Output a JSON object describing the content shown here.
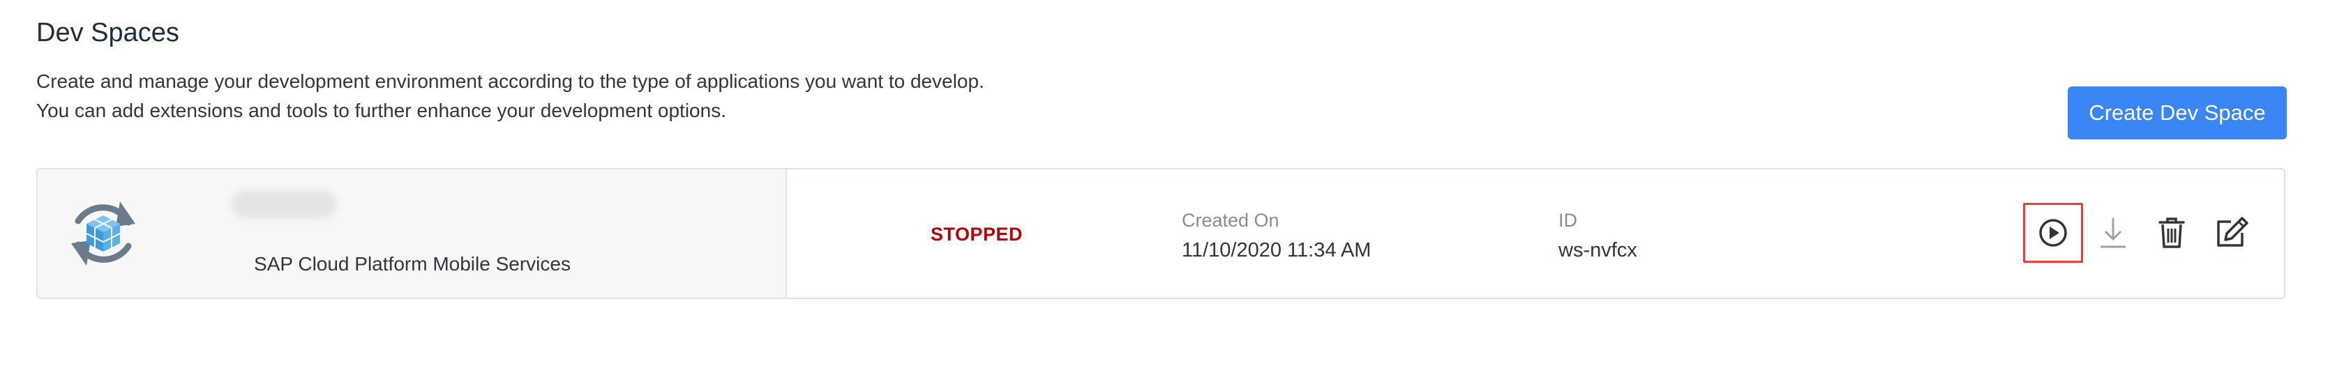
{
  "header": {
    "title": "Dev Spaces",
    "description_line1": "Create and manage your development environment according to the type of applications you want to develop.",
    "description_line2": "You can add extensions and tools to further enhance your development options.",
    "create_button_label": "Create Dev Space"
  },
  "devspaces": [
    {
      "name": "",
      "type": "SAP Cloud Platform Mobile Services",
      "icon": "mobile-services-sync-cube-icon",
      "status": "STOPPED",
      "created_label": "Created On",
      "created_value": "11/10/2020 11:34 AM",
      "id_label": "ID",
      "id_value": "ws-nvfcx",
      "actions": [
        "start-icon",
        "download-icon",
        "delete-icon",
        "edit-icon"
      ]
    }
  ],
  "colors": {
    "accent": "#3b86f7",
    "status_stopped": "#aa0808",
    "highlight_box": "#e0433a",
    "icon_gray": "#5b6b7b"
  }
}
